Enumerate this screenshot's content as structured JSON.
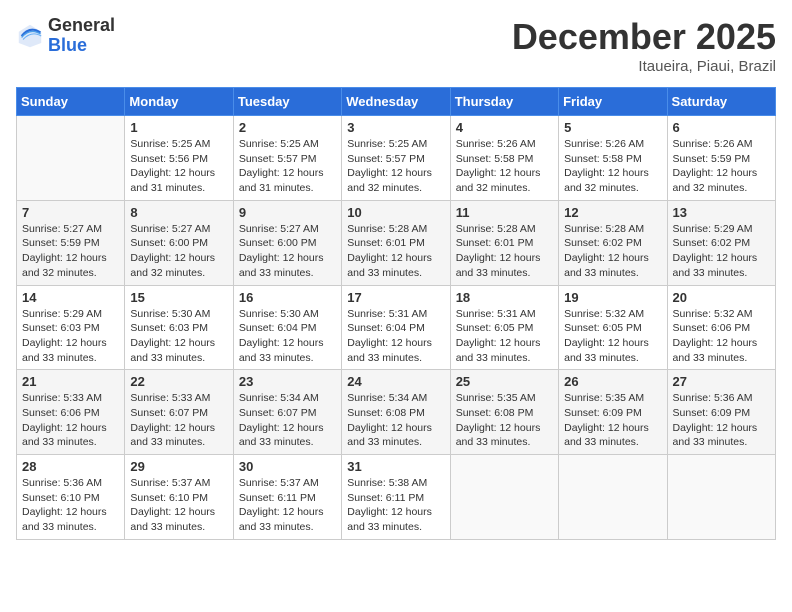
{
  "header": {
    "logo_general": "General",
    "logo_blue": "Blue",
    "month_title": "December 2025",
    "subtitle": "Itaueira, Piaui, Brazil"
  },
  "days_of_week": [
    "Sunday",
    "Monday",
    "Tuesday",
    "Wednesday",
    "Thursday",
    "Friday",
    "Saturday"
  ],
  "weeks": [
    [
      {
        "day": "",
        "info": ""
      },
      {
        "day": "1",
        "info": "Sunrise: 5:25 AM\nSunset: 5:56 PM\nDaylight: 12 hours\nand 31 minutes."
      },
      {
        "day": "2",
        "info": "Sunrise: 5:25 AM\nSunset: 5:57 PM\nDaylight: 12 hours\nand 31 minutes."
      },
      {
        "day": "3",
        "info": "Sunrise: 5:25 AM\nSunset: 5:57 PM\nDaylight: 12 hours\nand 32 minutes."
      },
      {
        "day": "4",
        "info": "Sunrise: 5:26 AM\nSunset: 5:58 PM\nDaylight: 12 hours\nand 32 minutes."
      },
      {
        "day": "5",
        "info": "Sunrise: 5:26 AM\nSunset: 5:58 PM\nDaylight: 12 hours\nand 32 minutes."
      },
      {
        "day": "6",
        "info": "Sunrise: 5:26 AM\nSunset: 5:59 PM\nDaylight: 12 hours\nand 32 minutes."
      }
    ],
    [
      {
        "day": "7",
        "info": "Sunrise: 5:27 AM\nSunset: 5:59 PM\nDaylight: 12 hours\nand 32 minutes."
      },
      {
        "day": "8",
        "info": "Sunrise: 5:27 AM\nSunset: 6:00 PM\nDaylight: 12 hours\nand 32 minutes."
      },
      {
        "day": "9",
        "info": "Sunrise: 5:27 AM\nSunset: 6:00 PM\nDaylight: 12 hours\nand 33 minutes."
      },
      {
        "day": "10",
        "info": "Sunrise: 5:28 AM\nSunset: 6:01 PM\nDaylight: 12 hours\nand 33 minutes."
      },
      {
        "day": "11",
        "info": "Sunrise: 5:28 AM\nSunset: 6:01 PM\nDaylight: 12 hours\nand 33 minutes."
      },
      {
        "day": "12",
        "info": "Sunrise: 5:28 AM\nSunset: 6:02 PM\nDaylight: 12 hours\nand 33 minutes."
      },
      {
        "day": "13",
        "info": "Sunrise: 5:29 AM\nSunset: 6:02 PM\nDaylight: 12 hours\nand 33 minutes."
      }
    ],
    [
      {
        "day": "14",
        "info": "Sunrise: 5:29 AM\nSunset: 6:03 PM\nDaylight: 12 hours\nand 33 minutes."
      },
      {
        "day": "15",
        "info": "Sunrise: 5:30 AM\nSunset: 6:03 PM\nDaylight: 12 hours\nand 33 minutes."
      },
      {
        "day": "16",
        "info": "Sunrise: 5:30 AM\nSunset: 6:04 PM\nDaylight: 12 hours\nand 33 minutes."
      },
      {
        "day": "17",
        "info": "Sunrise: 5:31 AM\nSunset: 6:04 PM\nDaylight: 12 hours\nand 33 minutes."
      },
      {
        "day": "18",
        "info": "Sunrise: 5:31 AM\nSunset: 6:05 PM\nDaylight: 12 hours\nand 33 minutes."
      },
      {
        "day": "19",
        "info": "Sunrise: 5:32 AM\nSunset: 6:05 PM\nDaylight: 12 hours\nand 33 minutes."
      },
      {
        "day": "20",
        "info": "Sunrise: 5:32 AM\nSunset: 6:06 PM\nDaylight: 12 hours\nand 33 minutes."
      }
    ],
    [
      {
        "day": "21",
        "info": "Sunrise: 5:33 AM\nSunset: 6:06 PM\nDaylight: 12 hours\nand 33 minutes."
      },
      {
        "day": "22",
        "info": "Sunrise: 5:33 AM\nSunset: 6:07 PM\nDaylight: 12 hours\nand 33 minutes."
      },
      {
        "day": "23",
        "info": "Sunrise: 5:34 AM\nSunset: 6:07 PM\nDaylight: 12 hours\nand 33 minutes."
      },
      {
        "day": "24",
        "info": "Sunrise: 5:34 AM\nSunset: 6:08 PM\nDaylight: 12 hours\nand 33 minutes."
      },
      {
        "day": "25",
        "info": "Sunrise: 5:35 AM\nSunset: 6:08 PM\nDaylight: 12 hours\nand 33 minutes."
      },
      {
        "day": "26",
        "info": "Sunrise: 5:35 AM\nSunset: 6:09 PM\nDaylight: 12 hours\nand 33 minutes."
      },
      {
        "day": "27",
        "info": "Sunrise: 5:36 AM\nSunset: 6:09 PM\nDaylight: 12 hours\nand 33 minutes."
      }
    ],
    [
      {
        "day": "28",
        "info": "Sunrise: 5:36 AM\nSunset: 6:10 PM\nDaylight: 12 hours\nand 33 minutes."
      },
      {
        "day": "29",
        "info": "Sunrise: 5:37 AM\nSunset: 6:10 PM\nDaylight: 12 hours\nand 33 minutes."
      },
      {
        "day": "30",
        "info": "Sunrise: 5:37 AM\nSunset: 6:11 PM\nDaylight: 12 hours\nand 33 minutes."
      },
      {
        "day": "31",
        "info": "Sunrise: 5:38 AM\nSunset: 6:11 PM\nDaylight: 12 hours\nand 33 minutes."
      },
      {
        "day": "",
        "info": ""
      },
      {
        "day": "",
        "info": ""
      },
      {
        "day": "",
        "info": ""
      }
    ]
  ]
}
